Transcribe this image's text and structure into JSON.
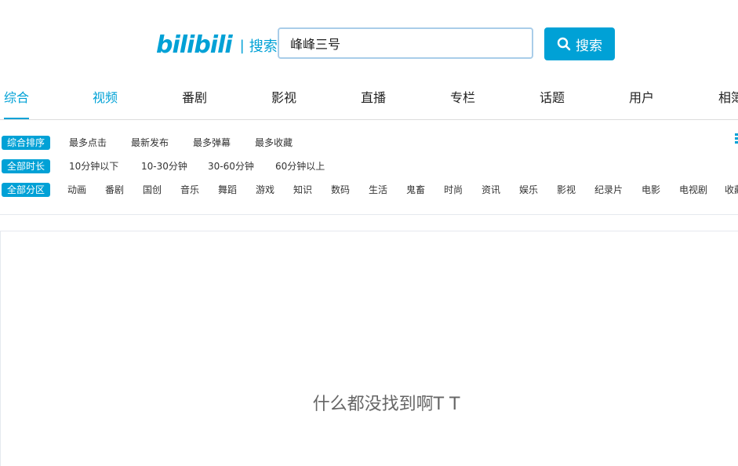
{
  "header": {
    "logo_text": "bilibili",
    "logo_separator": "|",
    "logo_subtitle": "搜索",
    "search_value": "峰峰三号",
    "search_button_label": "搜索",
    "accent_color": "#00a1d6"
  },
  "tabs": [
    {
      "label": "综合"
    },
    {
      "label": "视频"
    },
    {
      "label": "番剧"
    },
    {
      "label": "影视"
    },
    {
      "label": "直播"
    },
    {
      "label": "专栏"
    },
    {
      "label": "话题"
    },
    {
      "label": "用户"
    },
    {
      "label": "相簿"
    }
  ],
  "filters": {
    "sort": {
      "active_label": "综合排序",
      "options": [
        "最多点击",
        "最新发布",
        "最多弹幕",
        "最多收藏"
      ]
    },
    "duration": {
      "active_label": "全部时长",
      "options": [
        "10分钟以下",
        "10-30分钟",
        "30-60分钟",
        "60分钟以上"
      ]
    },
    "zone": {
      "active_label": "全部分区",
      "options": [
        "动画",
        "番剧",
        "国创",
        "音乐",
        "舞蹈",
        "游戏",
        "知识",
        "数码",
        "生活",
        "鬼畜",
        "时尚",
        "资讯",
        "娱乐",
        "影视",
        "纪录片",
        "电影",
        "电视剧",
        "收藏"
      ]
    }
  },
  "results": {
    "empty_message": "什么都没找到啊T T"
  }
}
